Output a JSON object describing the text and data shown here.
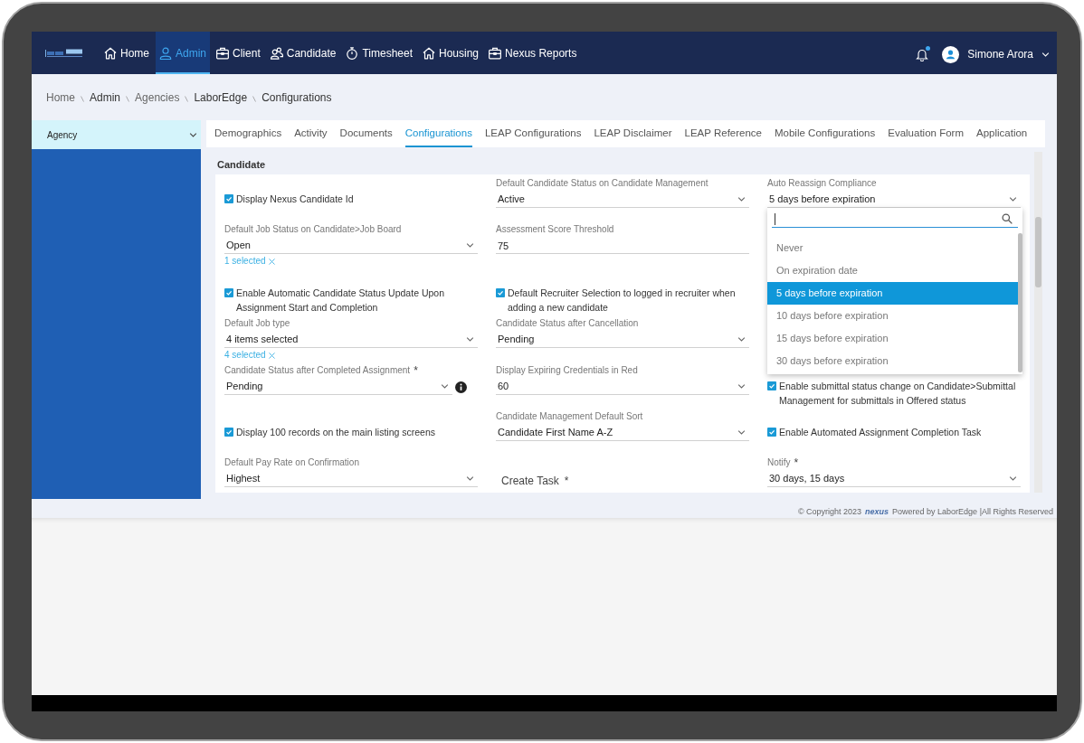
{
  "header": {
    "nav": [
      {
        "label": "Home",
        "selected": false
      },
      {
        "label": "Admin",
        "selected": true
      },
      {
        "label": "Client",
        "selected": false
      },
      {
        "label": "Candidate",
        "selected": false
      },
      {
        "label": "Timesheet",
        "selected": false
      },
      {
        "label": "Housing",
        "selected": false
      },
      {
        "label": "Nexus Reports",
        "selected": false
      }
    ],
    "notifications": {
      "unread": true
    },
    "user": {
      "name": "Simone Arora"
    }
  },
  "breadcrumb": [
    "Home",
    "Admin",
    "Agencies",
    "LaborEdge",
    "Configurations"
  ],
  "sidebar": {
    "items": [
      {
        "label": "Agency",
        "selected": true
      }
    ]
  },
  "tabs": [
    {
      "label": "Demographics",
      "selected": false
    },
    {
      "label": "Activity",
      "selected": false
    },
    {
      "label": "Documents",
      "selected": false
    },
    {
      "label": "Configurations",
      "selected": true
    },
    {
      "label": "LEAP Configurations",
      "selected": false
    },
    {
      "label": "LEAP Disclaimer",
      "selected": false
    },
    {
      "label": "LEAP Reference",
      "selected": false
    },
    {
      "label": "Mobile Configurations",
      "selected": false
    },
    {
      "label": "Evaluation Form",
      "selected": false
    },
    {
      "label": "Application",
      "selected": false
    }
  ],
  "section": {
    "title": "Candidate",
    "rows": [
      [
        {
          "kind": "checkbox",
          "label": "Display Nexus Candidate Id",
          "checked": true
        },
        {
          "kind": "select",
          "label": "Default Candidate Status on Candidate Management",
          "value": "Active"
        },
        {
          "kind": "select",
          "label": "Auto Reassign Compliance",
          "value": "5 days before expiration",
          "open": true,
          "options": [
            {
              "label": "Never",
              "selected": false
            },
            {
              "label": "On expiration date",
              "selected": false
            },
            {
              "label": "5 days before expiration",
              "selected": true
            },
            {
              "label": "10 days before expiration",
              "selected": false
            },
            {
              "label": "15 days before expiration",
              "selected": false
            },
            {
              "label": "30 days before expiration",
              "selected": false
            }
          ]
        }
      ],
      [
        {
          "kind": "select",
          "label": "Default Job Status on Candidate>Job Board",
          "value": "Open",
          "selection": "1 selected"
        },
        {
          "kind": "input",
          "label": "Assessment Score Threshold",
          "value": "75"
        },
        null
      ],
      [
        {
          "kind": "checkbox",
          "label": "Enable Automatic Candidate Status Update Upon Assignment Start and Completion",
          "checked": true
        },
        {
          "kind": "checkbox",
          "label": "Default Recruiter Selection to logged in recruiter when adding a new candidate",
          "checked": true
        },
        null
      ],
      [
        {
          "kind": "select",
          "label": "Default Job type",
          "value": "4 items selected",
          "selection": "4 selected"
        },
        {
          "kind": "select",
          "label": "Candidate Status after Cancellation",
          "value": "Pending"
        },
        null
      ],
      [
        {
          "kind": "select",
          "label": "Candidate Status after Completed Assignment",
          "required_mark": "*",
          "value": "Pending",
          "info": true
        },
        {
          "kind": "select",
          "label": "Display Expiring Credentials in Red",
          "value": "60"
        },
        {
          "kind": "checkbox",
          "label": "Enable submittal status change on Candidate>Submittal Management for submittals in Offered status",
          "checked": true
        }
      ],
      [
        {
          "kind": "checkbox",
          "label": "Display 100 records on the main listing screens",
          "checked": true
        },
        {
          "kind": "select",
          "label": "Candidate Management Default Sort",
          "value": "Candidate First Name A-Z"
        },
        {
          "kind": "checkbox",
          "label": "Enable Automated Assignment Completion Task",
          "checked": true
        }
      ],
      [
        {
          "kind": "select",
          "label": "Default Pay Rate on Confirmation",
          "value": "Highest"
        },
        {
          "kind": "heading",
          "label": "Create Task",
          "required_mark": "*"
        },
        {
          "kind": "select",
          "label": "Notify",
          "required_mark": "*",
          "value": "30 days, 15 days"
        }
      ]
    ]
  },
  "footer": {
    "copyright": "© Copyright 2023",
    "logo": "nexus",
    "text": "Powered by LaborEdge |All Rights Reserved"
  }
}
